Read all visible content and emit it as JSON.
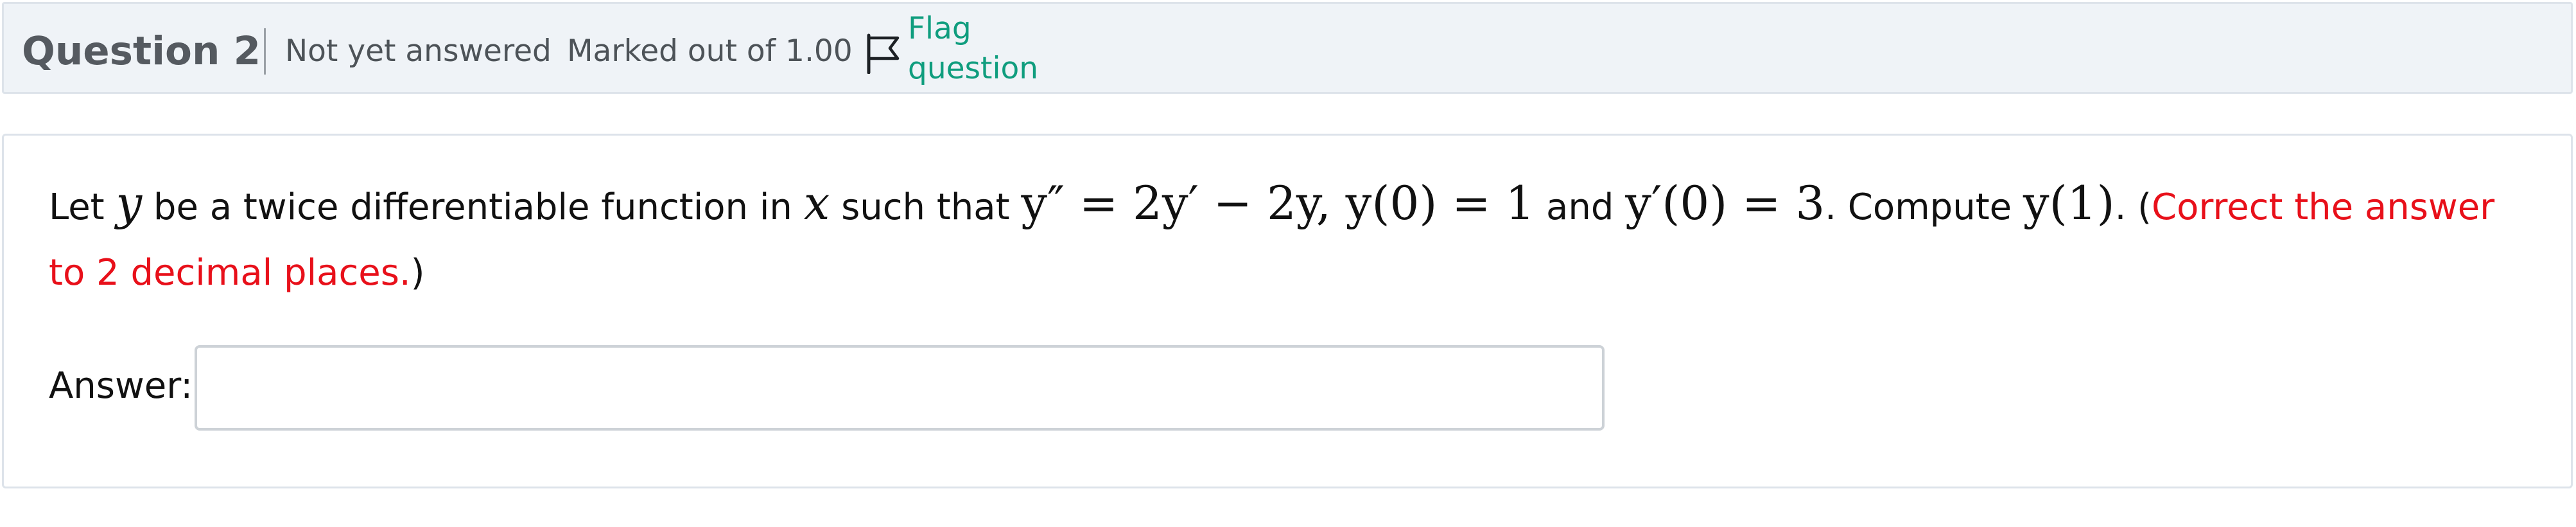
{
  "question": {
    "title": "Question 2",
    "state": "Not yet answered",
    "grade": "Marked out of 1.00",
    "flag": {
      "icon": "flag-icon",
      "line1": "Flag",
      "line2": "question"
    }
  },
  "body": {
    "t1": "Let ",
    "m1": "y",
    "t2": " be a twice differentiable function in ",
    "m2": "x",
    "t3": " such that ",
    "m3": "y″ = 2y′ − 2y, y(0) = 1",
    "t4": " and ",
    "m4": "y′(0) = 3",
    "t5": ". Compute ",
    "m5": "y(1)",
    "t6": ". (",
    "red": "Correct the answer to 2 decimal places.",
    "t7": ")"
  },
  "answer": {
    "label": "Answer:",
    "value": ""
  },
  "colors": {
    "header_bg": "#eff3f7",
    "flag_link": "#0f9d7e",
    "emphasis": "#e8101a"
  }
}
